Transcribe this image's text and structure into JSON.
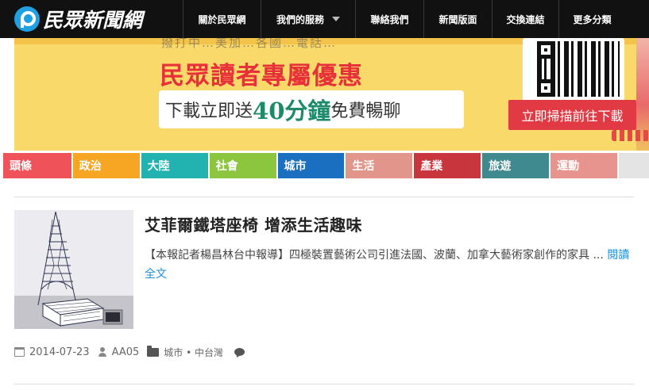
{
  "site": {
    "logo_text": "民眾新聞網",
    "brand_color": "#1fa0e0"
  },
  "nav": {
    "items": [
      {
        "label": "關於民眾網"
      },
      {
        "label": "我們的服務",
        "has_dropdown": true
      },
      {
        "label": "聯絡我們"
      },
      {
        "label": "新聞版面"
      },
      {
        "label": "交換連結"
      },
      {
        "label": "更多分類"
      }
    ]
  },
  "banner": {
    "partial_top_text": "撥打中…美加…各國…電話…",
    "title": "民眾讀者專屬優惠",
    "promo_prefix": "下載立即送",
    "promo_highlight": "40分鐘",
    "promo_suffix": "免費暢聊",
    "scan_label": "立即掃描前往下載",
    "colors": {
      "background": "#f9d96a",
      "title": "#e8303a",
      "highlight": "#1d8a6a",
      "scan": "#e23a44"
    }
  },
  "categories": [
    {
      "label": "頭條",
      "color": "#f0525a"
    },
    {
      "label": "政治",
      "color": "#f6a623"
    },
    {
      "label": "大陸",
      "color": "#22b3b0"
    },
    {
      "label": "社會",
      "color": "#8cc63f"
    },
    {
      "label": "城市",
      "color": "#1b6fc0"
    },
    {
      "label": "生活",
      "color": "#e2958a"
    },
    {
      "label": "產業",
      "color": "#c9353d"
    },
    {
      "label": "旅遊",
      "color": "#3f8a8e"
    },
    {
      "label": "運動",
      "color": "#e7948e"
    },
    {
      "label": "",
      "color": "#e4e4e4"
    }
  ],
  "article": {
    "title": "艾菲爾鐵塔座椅 增添生活趣味",
    "excerpt": "【本報記者楊昌林台中報導】四極裝置藝術公司引進法國、波蘭、加拿大藝術家創作的家具 ...",
    "read_more": "閱讀全文",
    "thumbnail_alt": "eiffel-tower-chair",
    "meta": {
      "date": "2014-07-23",
      "author": "AA05",
      "categories": "城市 • 中台灣"
    }
  }
}
